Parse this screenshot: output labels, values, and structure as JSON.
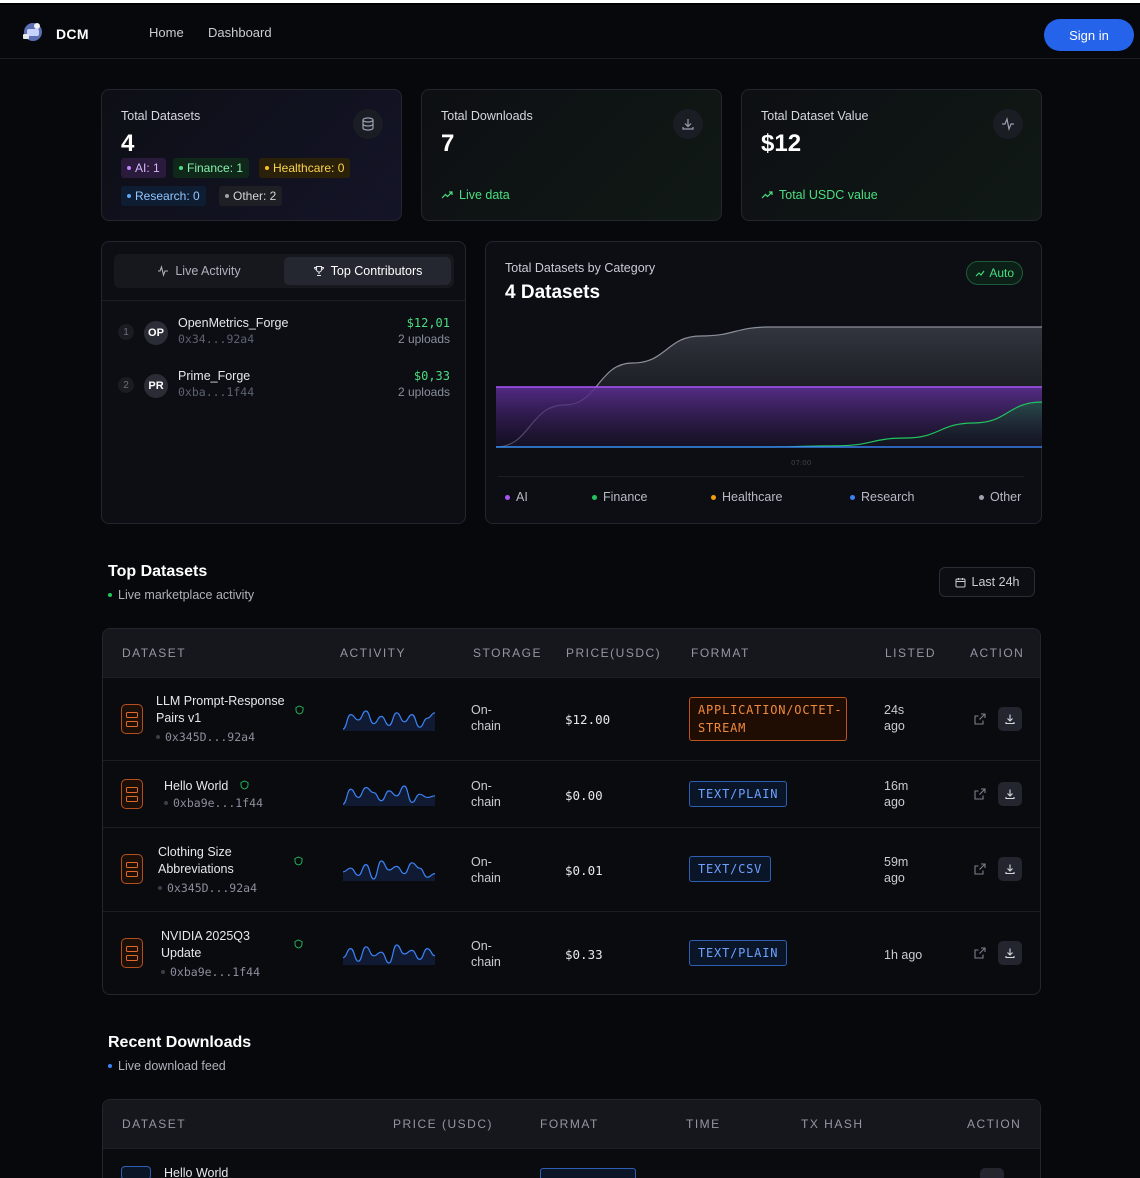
{
  "nav": {
    "brand": "DCM",
    "links": [
      "Home",
      "Dashboard"
    ],
    "sign_in": "Sign in"
  },
  "stats": [
    {
      "label": "Total Datasets",
      "value": "4",
      "icon": "database-icon"
    },
    {
      "label": "Total Downloads",
      "value": "7",
      "footer": "Live data",
      "icon": "download-icon"
    },
    {
      "label": "Total Dataset Value",
      "value": "$12",
      "footer": "Total USDC value",
      "icon": "activity-icon"
    }
  ],
  "category_chips": [
    {
      "label": "AI: 1",
      "color": "#c084fc"
    },
    {
      "label": "Finance: 1",
      "color": "#4ade80"
    },
    {
      "label": "Healthcare: 0",
      "color": "#fbbf24"
    },
    {
      "label": "Research: 0",
      "color": "#60a5fa"
    },
    {
      "label": "Other: 2",
      "color": "#a1a1aa"
    }
  ],
  "activity_panel": {
    "tabs": [
      "Live Activity",
      "Top Contributors"
    ],
    "active_tab": "Top Contributors",
    "contributors": [
      {
        "rank": "1",
        "initials": "OP",
        "name": "OpenMetrics_Forge",
        "address": "0x34...92a4",
        "amount": "$12,01",
        "uploads": "2 uploads"
      },
      {
        "rank": "2",
        "initials": "PR",
        "name": "Prime_Forge",
        "address": "0xba...1f44",
        "amount": "$0,33",
        "uploads": "2 uploads"
      }
    ]
  },
  "category_chart": {
    "subtitle": "Total Datasets by Category",
    "title": "4 Datasets",
    "badge": "Auto",
    "x_tick": "07:00",
    "legend": [
      {
        "name": "AI",
        "color": "#a855f7"
      },
      {
        "name": "Finance",
        "color": "#22c55e"
      },
      {
        "name": "Healthcare",
        "color": "#f59e0b"
      },
      {
        "name": "Research",
        "color": "#3b82f6"
      },
      {
        "name": "Other",
        "color": "#9ca3af"
      }
    ]
  },
  "chart_data": {
    "type": "area",
    "title": "4 Datasets",
    "xlabel": "",
    "ylabel": "",
    "x_ticks": [
      "07:00"
    ],
    "series": [
      {
        "name": "Other",
        "values": [
          0,
          0.7,
          1.4,
          1.85,
          2,
          2,
          2,
          2,
          2
        ]
      },
      {
        "name": "AI",
        "values": [
          1,
          1,
          1,
          1,
          1,
          1,
          1,
          1,
          1
        ]
      },
      {
        "name": "Finance",
        "values": [
          0,
          0,
          0,
          0,
          0,
          0.02,
          0.15,
          0.4,
          0.75
        ]
      },
      {
        "name": "Research",
        "values": [
          0,
          0,
          0,
          0,
          0,
          0,
          0,
          0,
          0
        ]
      },
      {
        "name": "Healthcare",
        "values": [
          0,
          0,
          0,
          0,
          0,
          0,
          0,
          0,
          0
        ]
      }
    ],
    "ylim": [
      0,
      2.05
    ],
    "legend": "bottom",
    "grid": false
  },
  "top_datasets": {
    "title": "Top Datasets",
    "subtitle": "Live marketplace activity",
    "range_button": "Last 24h",
    "columns": [
      "DATASET",
      "ACTIVITY",
      "STORAGE",
      "PRICE(USDC)",
      "FORMAT",
      "LISTED",
      "ACTION"
    ],
    "rows": [
      {
        "name": "LLM Prompt-Response Pairs v1",
        "address": "0x345D...92a4",
        "storage": "On-chain",
        "price": "$12.00",
        "format": "APPLICATION/OCTET-STREAM",
        "listed": "24s ago",
        "spark": [
          6,
          14,
          11,
          16,
          9,
          13,
          8,
          15,
          10,
          14,
          7,
          12,
          15
        ]
      },
      {
        "name": "Hello World",
        "address": "0xba9e...1f44",
        "storage": "On-chain",
        "price": "$0.00",
        "format": "TEXT/PLAIN",
        "listed": "16m ago",
        "spark": [
          5,
          14,
          9,
          15,
          12,
          7,
          13,
          10,
          16,
          6,
          11,
          9,
          10
        ]
      },
      {
        "name": "Clothing Size Abbreviations",
        "address": "0x345D...92a4",
        "storage": "On-chain",
        "price": "$0.01",
        "format": "TEXT/CSV",
        "listed": "59m ago",
        "spark": [
          10,
          12,
          8,
          14,
          6,
          16,
          11,
          13,
          9,
          15,
          12,
          7,
          9
        ]
      },
      {
        "name": "NVIDIA 2025Q3 Update",
        "address": "0xba9e...1f44",
        "storage": "On-chain",
        "price": "$0.33",
        "format": "TEXT/PLAIN",
        "listed": "1h ago",
        "spark": [
          9,
          14,
          7,
          15,
          10,
          12,
          6,
          16,
          11,
          13,
          8,
          14,
          10
        ]
      }
    ]
  },
  "recent_downloads": {
    "title": "Recent Downloads",
    "subtitle": "Live download feed",
    "columns": [
      "DATASET",
      "PRICE (USDC)",
      "FORMAT",
      "TIME",
      "TX HASH",
      "ACTION"
    ],
    "first_row_name": "Hello World"
  }
}
